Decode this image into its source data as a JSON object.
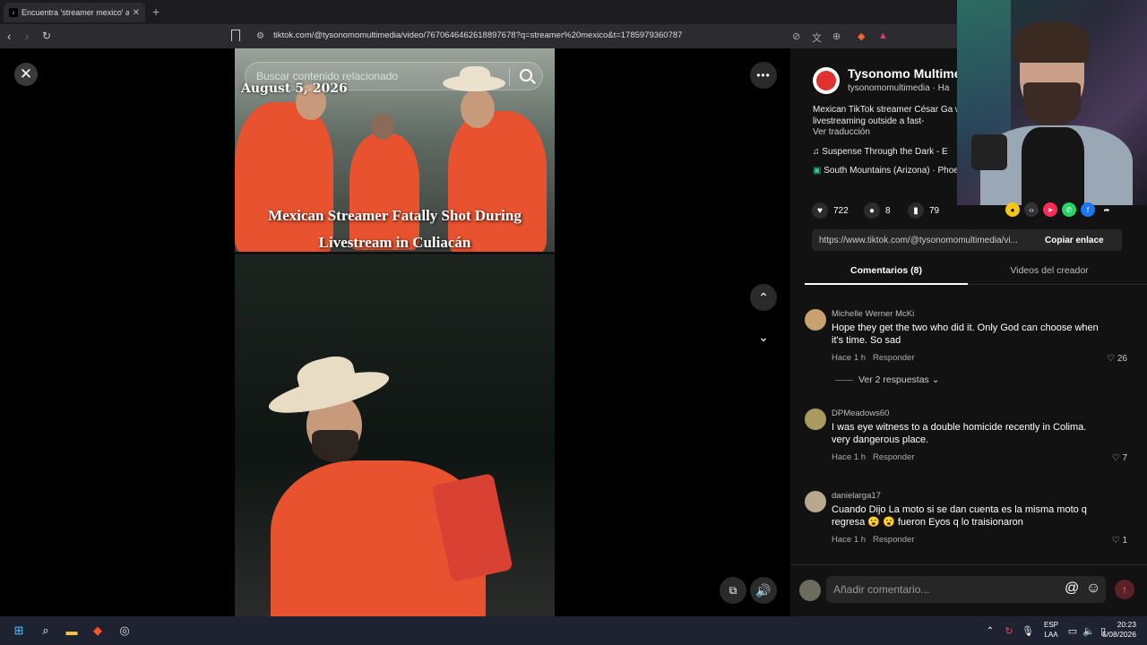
{
  "browser": {
    "tab_title": "Encuentra 'streamer mexico' a",
    "new_tab": "+",
    "url": "tiktok.com/@tysonomomultimedia/video/7670646462618897678?q=streamer%20mexico&t=1785979360787"
  },
  "video": {
    "search_placeholder": "Buscar contenido relacionado",
    "date_overlay": "August 5, 2026",
    "headline": "Mexican Streamer Fatally Shot During Livestream in Culiacán"
  },
  "creator": {
    "name": "Tysonomo Multime",
    "handle": "tysonomomultimedia · Ha",
    "description": "Mexican TikTok streamer César Ga while livestreaming outside a fast-",
    "translate": "Ver traducción",
    "music": "Suspense Through the Dark - E",
    "location": "South Mountains (Arizona) · Phoe"
  },
  "stats": {
    "likes": "722",
    "comments": "8",
    "saves": "79"
  },
  "link": {
    "url": "https://www.tiktok.com/@tysonomomultimedia/vi...",
    "copy_label": "Copiar enlace"
  },
  "tabs": {
    "comments": "Comentarios (8)",
    "creator_videos": "Videos del creador"
  },
  "comments": [
    {
      "user": "Michelle Werner McKi",
      "text": "Hope they get the two who did it. Only God can choose when it's time. So sad",
      "time": "Hace 1 h",
      "reply": "Responder",
      "likes": "26"
    },
    {
      "user": "DPMeadows60",
      "text": "I was eye witness to a double homicide recently in Colima. very dangerous place.",
      "time": "Hace 1 h",
      "reply": "Responder",
      "likes": "7"
    },
    {
      "user": "danielarga17",
      "text": "Cuando Dijo La moto si se dan cuenta es la misma moto q regresa 😮 😮 fueron Eyos q lo traisionaron",
      "time": "Hace 1 h",
      "reply": "Responder",
      "likes": "1"
    }
  ],
  "view_replies": "Ver 2 respuestas",
  "comment_input": {
    "placeholder": "Añadir comentario..."
  },
  "taskbar": {
    "lang_top": "ESP",
    "lang_bottom": "LAA",
    "time": "20:23",
    "date": "5/08/2026"
  },
  "colors": {
    "tiktok_red": "#fe2c55",
    "jacket_orange": "#e8522e",
    "panel_bg": "#121212"
  }
}
